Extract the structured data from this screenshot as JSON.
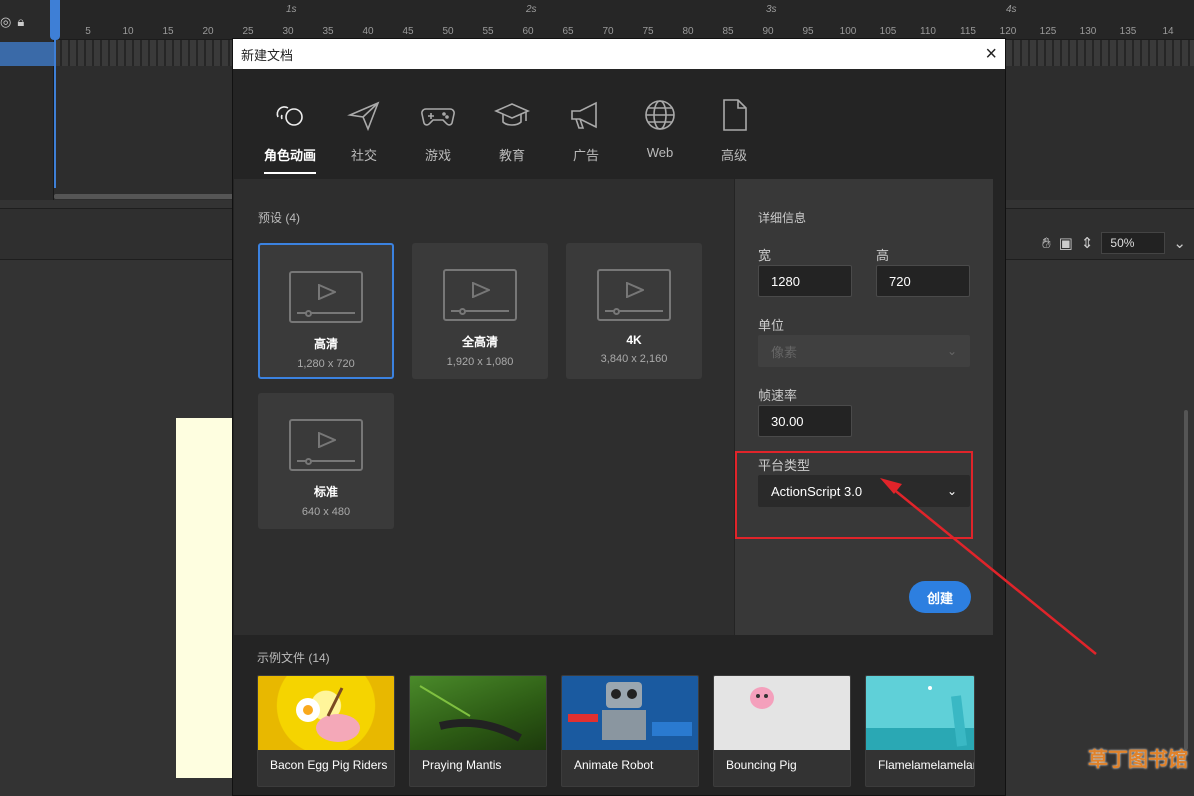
{
  "timeline": {
    "frame_labels": [
      "5",
      "10",
      "15",
      "20",
      "25",
      "30",
      "35",
      "40",
      "45",
      "50",
      "55",
      "60",
      "65",
      "70",
      "75",
      "80",
      "85",
      "90",
      "95",
      "100",
      "105",
      "110",
      "115",
      "120",
      "125",
      "130",
      "135",
      "14"
    ],
    "second_labels": [
      "1s",
      "2s",
      "3s",
      "4s"
    ]
  },
  "view_toolbar": {
    "zoom_value": "50%"
  },
  "dialog": {
    "title": "新建文档",
    "close_glyph": "×",
    "categories": [
      {
        "label": "角色动画",
        "icon": "character-animation-icon",
        "active": true
      },
      {
        "label": "社交",
        "icon": "paper-plane-icon",
        "active": false
      },
      {
        "label": "游戏",
        "icon": "gamepad-icon",
        "active": false
      },
      {
        "label": "教育",
        "icon": "graduation-cap-icon",
        "active": false
      },
      {
        "label": "广告",
        "icon": "megaphone-icon",
        "active": false
      },
      {
        "label": "Web",
        "icon": "globe-icon",
        "active": false
      },
      {
        "label": "高级",
        "icon": "document-icon",
        "active": false
      }
    ],
    "presets": {
      "title": "预设 (4)",
      "items": [
        {
          "name": "高清",
          "size": "1,280 x 720",
          "selected": true
        },
        {
          "name": "全高清",
          "size": "1,920 x 1,080",
          "selected": false
        },
        {
          "name": "4K",
          "size": "3,840 x 2,160",
          "selected": false
        },
        {
          "name": "标准",
          "size": "640 x 480",
          "selected": false
        }
      ]
    },
    "details": {
      "title": "详细信息",
      "width_label": "宽",
      "width_value": "1280",
      "height_label": "高",
      "height_value": "720",
      "unit_label": "单位",
      "unit_value": "像素",
      "fps_label": "帧速率",
      "fps_value": "30.00",
      "platform_label": "平台类型",
      "platform_value": "ActionScript 3.0",
      "create_label": "创建"
    },
    "examples": {
      "title": "示例文件 (14)",
      "items": [
        {
          "name": "Bacon Egg Pig Riders"
        },
        {
          "name": "Praying Mantis"
        },
        {
          "name": "Animate Robot"
        },
        {
          "name": "Bouncing Pig"
        },
        {
          "name": "Flamelamelamelame"
        }
      ]
    }
  },
  "watermark": {
    "text": "草丁图书馆"
  },
  "colors": {
    "accent": "#2d7fe0",
    "highlight_box": "#e0242a",
    "selected_border": "#3b82e0"
  }
}
